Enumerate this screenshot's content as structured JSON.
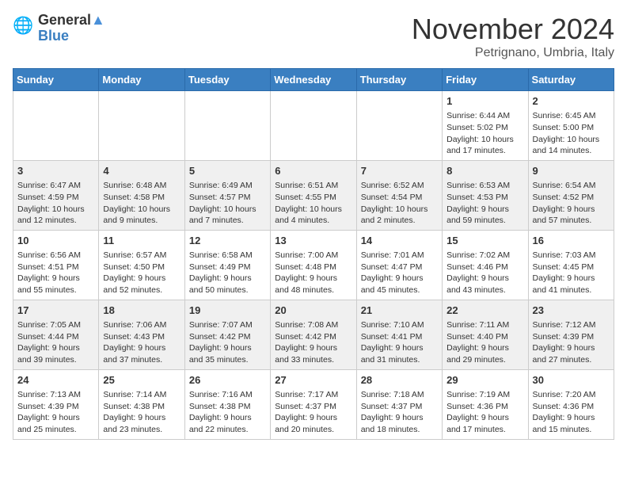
{
  "logo": {
    "line1": "General",
    "line2": "Blue"
  },
  "title": "November 2024",
  "location": "Petrignano, Umbria, Italy",
  "weekdays": [
    "Sunday",
    "Monday",
    "Tuesday",
    "Wednesday",
    "Thursday",
    "Friday",
    "Saturday"
  ],
  "weeks": [
    [
      {
        "day": "",
        "info": ""
      },
      {
        "day": "",
        "info": ""
      },
      {
        "day": "",
        "info": ""
      },
      {
        "day": "",
        "info": ""
      },
      {
        "day": "",
        "info": ""
      },
      {
        "day": "1",
        "info": "Sunrise: 6:44 AM\nSunset: 5:02 PM\nDaylight: 10 hours and 17 minutes."
      },
      {
        "day": "2",
        "info": "Sunrise: 6:45 AM\nSunset: 5:00 PM\nDaylight: 10 hours and 14 minutes."
      }
    ],
    [
      {
        "day": "3",
        "info": "Sunrise: 6:47 AM\nSunset: 4:59 PM\nDaylight: 10 hours and 12 minutes."
      },
      {
        "day": "4",
        "info": "Sunrise: 6:48 AM\nSunset: 4:58 PM\nDaylight: 10 hours and 9 minutes."
      },
      {
        "day": "5",
        "info": "Sunrise: 6:49 AM\nSunset: 4:57 PM\nDaylight: 10 hours and 7 minutes."
      },
      {
        "day": "6",
        "info": "Sunrise: 6:51 AM\nSunset: 4:55 PM\nDaylight: 10 hours and 4 minutes."
      },
      {
        "day": "7",
        "info": "Sunrise: 6:52 AM\nSunset: 4:54 PM\nDaylight: 10 hours and 2 minutes."
      },
      {
        "day": "8",
        "info": "Sunrise: 6:53 AM\nSunset: 4:53 PM\nDaylight: 9 hours and 59 minutes."
      },
      {
        "day": "9",
        "info": "Sunrise: 6:54 AM\nSunset: 4:52 PM\nDaylight: 9 hours and 57 minutes."
      }
    ],
    [
      {
        "day": "10",
        "info": "Sunrise: 6:56 AM\nSunset: 4:51 PM\nDaylight: 9 hours and 55 minutes."
      },
      {
        "day": "11",
        "info": "Sunrise: 6:57 AM\nSunset: 4:50 PM\nDaylight: 9 hours and 52 minutes."
      },
      {
        "day": "12",
        "info": "Sunrise: 6:58 AM\nSunset: 4:49 PM\nDaylight: 9 hours and 50 minutes."
      },
      {
        "day": "13",
        "info": "Sunrise: 7:00 AM\nSunset: 4:48 PM\nDaylight: 9 hours and 48 minutes."
      },
      {
        "day": "14",
        "info": "Sunrise: 7:01 AM\nSunset: 4:47 PM\nDaylight: 9 hours and 45 minutes."
      },
      {
        "day": "15",
        "info": "Sunrise: 7:02 AM\nSunset: 4:46 PM\nDaylight: 9 hours and 43 minutes."
      },
      {
        "day": "16",
        "info": "Sunrise: 7:03 AM\nSunset: 4:45 PM\nDaylight: 9 hours and 41 minutes."
      }
    ],
    [
      {
        "day": "17",
        "info": "Sunrise: 7:05 AM\nSunset: 4:44 PM\nDaylight: 9 hours and 39 minutes."
      },
      {
        "day": "18",
        "info": "Sunrise: 7:06 AM\nSunset: 4:43 PM\nDaylight: 9 hours and 37 minutes."
      },
      {
        "day": "19",
        "info": "Sunrise: 7:07 AM\nSunset: 4:42 PM\nDaylight: 9 hours and 35 minutes."
      },
      {
        "day": "20",
        "info": "Sunrise: 7:08 AM\nSunset: 4:42 PM\nDaylight: 9 hours and 33 minutes."
      },
      {
        "day": "21",
        "info": "Sunrise: 7:10 AM\nSunset: 4:41 PM\nDaylight: 9 hours and 31 minutes."
      },
      {
        "day": "22",
        "info": "Sunrise: 7:11 AM\nSunset: 4:40 PM\nDaylight: 9 hours and 29 minutes."
      },
      {
        "day": "23",
        "info": "Sunrise: 7:12 AM\nSunset: 4:39 PM\nDaylight: 9 hours and 27 minutes."
      }
    ],
    [
      {
        "day": "24",
        "info": "Sunrise: 7:13 AM\nSunset: 4:39 PM\nDaylight: 9 hours and 25 minutes."
      },
      {
        "day": "25",
        "info": "Sunrise: 7:14 AM\nSunset: 4:38 PM\nDaylight: 9 hours and 23 minutes."
      },
      {
        "day": "26",
        "info": "Sunrise: 7:16 AM\nSunset: 4:38 PM\nDaylight: 9 hours and 22 minutes."
      },
      {
        "day": "27",
        "info": "Sunrise: 7:17 AM\nSunset: 4:37 PM\nDaylight: 9 hours and 20 minutes."
      },
      {
        "day": "28",
        "info": "Sunrise: 7:18 AM\nSunset: 4:37 PM\nDaylight: 9 hours and 18 minutes."
      },
      {
        "day": "29",
        "info": "Sunrise: 7:19 AM\nSunset: 4:36 PM\nDaylight: 9 hours and 17 minutes."
      },
      {
        "day": "30",
        "info": "Sunrise: 7:20 AM\nSunset: 4:36 PM\nDaylight: 9 hours and 15 minutes."
      }
    ]
  ]
}
